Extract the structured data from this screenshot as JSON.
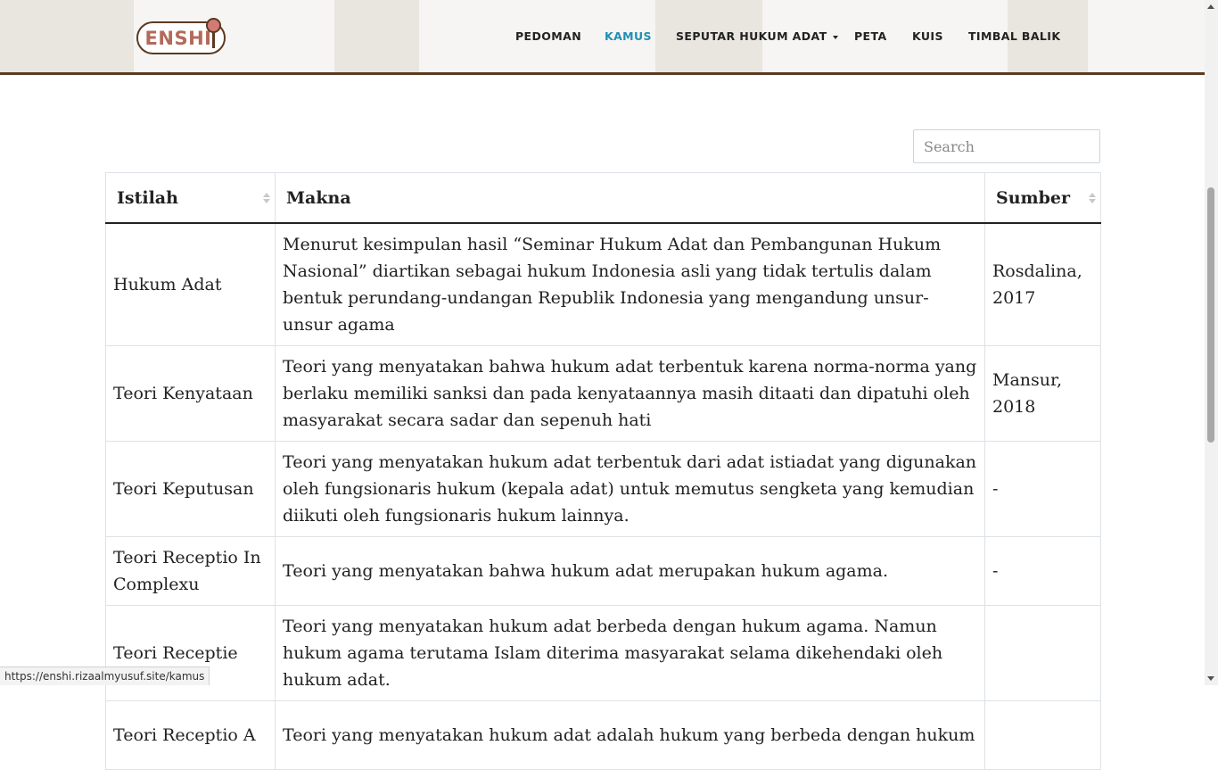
{
  "brand": {
    "logo_text": "ENSHI"
  },
  "nav": {
    "items": [
      {
        "label": "PEDOMAN"
      },
      {
        "label": "KAMUS"
      },
      {
        "label": "SEPUTAR HUKUM ADAT"
      },
      {
        "label": "PETA"
      },
      {
        "label": "KUIS"
      },
      {
        "label": "TIMBAL BALIK"
      }
    ],
    "active_color": "#1f8fb5"
  },
  "search": {
    "placeholder": "Search",
    "value": ""
  },
  "table": {
    "headers": [
      "Istilah",
      "Makna",
      "Sumber"
    ],
    "rows": [
      {
        "istilah": "Hukum Adat",
        "makna": "Menurut kesimpulan hasil “Seminar Hukum Adat dan Pembangunan Hukum Nasional” diartikan sebagai hukum Indonesia asli yang tidak tertulis dalam bentuk perundang-undangan Republik Indonesia yang mengandung unsur-unsur agama",
        "sumber": "Rosdalina, 2017"
      },
      {
        "istilah": "Teori Kenyataan",
        "makna": "Teori yang menyatakan bahwa hukum adat terbentuk karena norma-norma yang berlaku memiliki sanksi dan pada kenyataannya masih ditaati dan dipatuhi oleh masyarakat secara sadar dan sepenuh hati",
        "sumber": "Mansur, 2018"
      },
      {
        "istilah": "Teori Keputusan",
        "makna": "Teori yang menyatakan hukum adat terbentuk dari adat istiadat yang digunakan oleh fungsionaris hukum (kepala adat) untuk memutus sengketa yang kemudian diikuti oleh fungsionaris hukum lainnya.",
        "sumber": "-"
      },
      {
        "istilah": "Teori Receptio In Complexu",
        "makna": "Teori yang menyatakan bahwa hukum adat merupakan hukum agama.",
        "sumber": "-"
      },
      {
        "istilah": "Teori Receptie",
        "makna": "Teori yang menyatakan hukum adat berbeda dengan hukum agama. Namun hukum agama terutama Islam diterima masyarakat selama dikehendaki oleh hukum adat.",
        "sumber": ""
      },
      {
        "istilah": "Teori Receptio A",
        "makna": "Teori yang menyatakan hukum adat adalah hukum yang berbeda dengan hukum",
        "sumber": ""
      }
    ]
  },
  "statusbar": {
    "url": "https://enshi.rizaalmyusuf.site/kamus"
  }
}
